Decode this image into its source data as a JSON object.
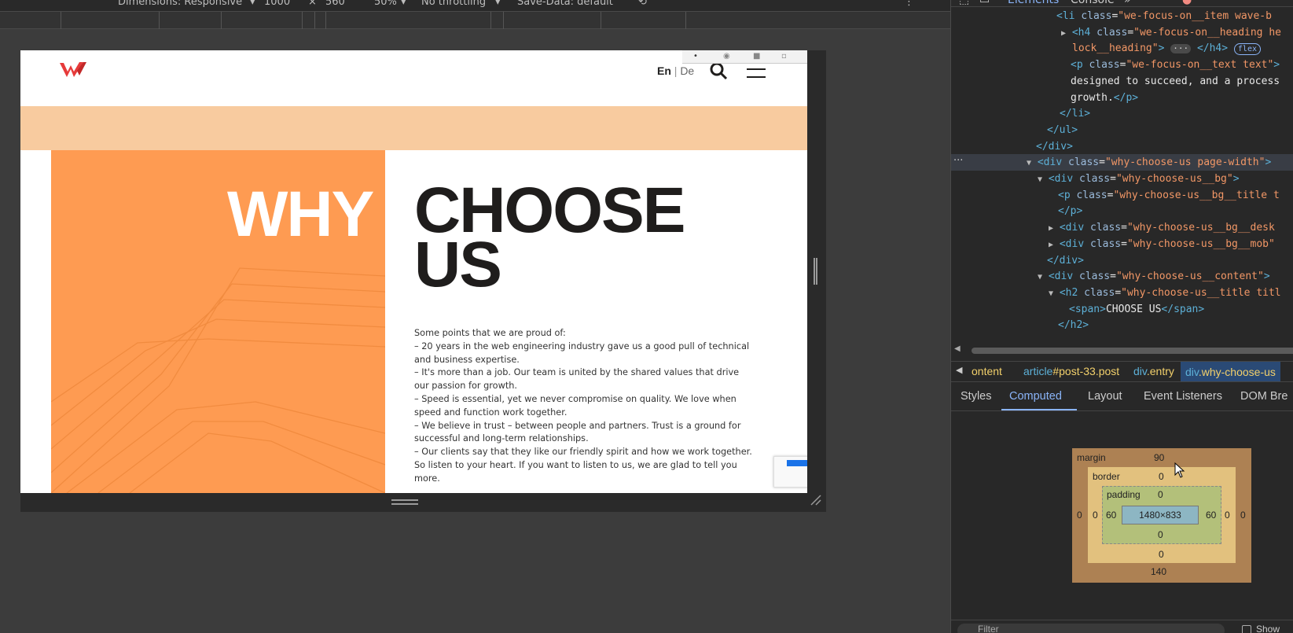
{
  "device_toolbar": {
    "dimensions_label": "Dimensions: Responsive",
    "width": "1000",
    "times": "×",
    "height": "560",
    "zoom": "50%",
    "throttling": "No throttling",
    "save_data": "Save-Data: default"
  },
  "site": {
    "lang_en": "En",
    "lang_sep": "|",
    "lang_de": "De",
    "title_why": "WHY",
    "title_choose": "CHOOSE US",
    "body_lines": [
      "Some points that we are proud of:",
      "– 20 years in the web engineering industry gave us a good pull of technical and business expertise.",
      "– It's more than a job. Our team is united by the shared values that drive our passion for growth.",
      "– Speed is essential, yet we never compromise on quality. We love when speed and function work together.",
      "– We believe in trust – between people and partners. Trust is a ground for successful and long-term relationships.",
      "– Our clients say that they like our friendly spirit and how we work together. So listen to your heart. If you want to listen to us, we are glad to tell you more."
    ],
    "brand_colors": {
      "orange": "#fe9b52",
      "peach": "#f8cb9f",
      "logo_red": "#e63a3a",
      "dark": "#1f1d1c"
    }
  },
  "devtools": {
    "tabs": [
      "Elements",
      "Console",
      "»"
    ],
    "dom_lines": [
      {
        "indent": 134,
        "html": "<span class='tag'>&lt;li</span> <span class='attr'>class</span>=<span class='val'>\"we-focus-on__item wave-b</span>"
      },
      {
        "indent": 140,
        "arrow": "▶",
        "html": "<span class='tag'>&lt;h4</span> <span class='attr'>class</span>=<span class='val'>\"we-focus-on__heading he</span>"
      },
      {
        "indent": 154,
        "html": "<span class='val'>lock__heading\"</span><span class='tag'>&gt;</span> <span class='ellip'>···</span> <span class='tag'>&lt;/h4&gt;</span> <span class='flex-badge'>flex</span>"
      },
      {
        "indent": 152,
        "html": "<span class='tag'>&lt;p</span> <span class='attr'>class</span>=<span class='val'>\"we-focus-on__text text\"</span><span class='tag'>&gt;</span>"
      },
      {
        "indent": 152,
        "html": "<span class='txt'>designed to succeed, and a process</span>"
      },
      {
        "indent": 152,
        "html": "<span class='txt'>growth.</span><span class='tag'>&lt;/p&gt;</span>"
      },
      {
        "indent": 138,
        "html": "<span class='tag'>&lt;/li&gt;</span>"
      },
      {
        "indent": 122,
        "html": "<span class='tag'>&lt;/ul&gt;</span>"
      },
      {
        "indent": 108,
        "html": "<span class='tag'>&lt;/div&gt;</span>"
      },
      {
        "indent": 96,
        "arrow": "▼",
        "sel": true,
        "html": "<span class='tag'>&lt;div</span> <span class='attr'>class</span>=<span class='val'>\"why-choose-us page-width\"</span><span class='tag'>&gt;</span>"
      },
      {
        "indent": 110,
        "arrow": "▼",
        "html": "<span class='tag'>&lt;div</span> <span class='attr'>class</span>=<span class='val'>\"why-choose-us__bg\"</span><span class='tag'>&gt;</span>"
      },
      {
        "indent": 136,
        "html": "<span class='tag'>&lt;p</span> <span class='attr'>class</span>=<span class='val'>\"why-choose-us__bg__title t</span>"
      },
      {
        "indent": 136,
        "html": "<span class='tag'>&lt;/p&gt;</span>"
      },
      {
        "indent": 124,
        "arrow": "▶",
        "html": "<span class='tag'>&lt;div</span> <span class='attr'>class</span>=<span class='val'>\"why-choose-us__bg__desk</span>"
      },
      {
        "indent": 124,
        "arrow": "▶",
        "html": "<span class='tag'>&lt;div</span> <span class='attr'>class</span>=<span class='val'>\"why-choose-us__bg__mob\"</span>"
      },
      {
        "indent": 122,
        "html": "<span class='tag'>&lt;/div&gt;</span>"
      },
      {
        "indent": 110,
        "arrow": "▼",
        "html": "<span class='tag'>&lt;div</span> <span class='attr'>class</span>=<span class='val'>\"why-choose-us__content\"</span><span class='tag'>&gt;</span>"
      },
      {
        "indent": 124,
        "arrow": "▼",
        "html": "<span class='tag'>&lt;h2</span> <span class='attr'>class</span>=<span class='val'>\"why-choose-us__title titl</span>"
      },
      {
        "indent": 150,
        "html": "<span class='tag'>&lt;span&gt;</span><span class='txt'>CHOOSE US</span><span class='tag'>&lt;/span&gt;</span>"
      },
      {
        "indent": 136,
        "html": "<span class='tag'>&lt;/h2&gt;</span>"
      }
    ],
    "breadcrumbs": [
      {
        "tag": "",
        "id": "ontent"
      },
      {
        "tag": "article",
        "id": "#post-33.post"
      },
      {
        "tag": "div",
        "id": ".entry"
      },
      {
        "tag": "div",
        "id": ".why-choose-us"
      }
    ],
    "panel_tabs": [
      "Styles",
      "Computed",
      "Layout",
      "Event Listeners",
      "DOM Bre"
    ],
    "box_model": {
      "margin_label": "margin",
      "margin_top": "90",
      "margin_bottom": "140",
      "margin_left": "0",
      "margin_right": "0",
      "border_label": "border",
      "border_top": "0",
      "border_bottom": "0",
      "border_left": "0",
      "border_right": "0",
      "padding_label": "padding",
      "padding_top": "0",
      "padding_bottom": "0",
      "padding_left": "60",
      "padding_right": "60",
      "content_size": "1480×833"
    },
    "filter_placeholder": "Filter",
    "show_all_label": "Show"
  }
}
